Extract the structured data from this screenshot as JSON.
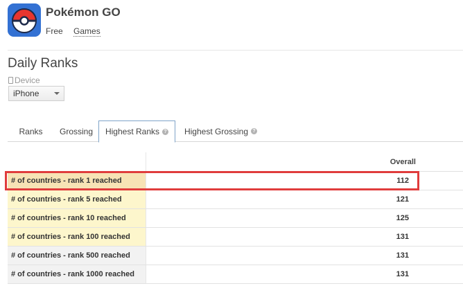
{
  "app": {
    "title": "Pokémon GO",
    "price": "Free",
    "category": "Games",
    "icon": "pokeball-icon"
  },
  "section": {
    "title": "Daily Ranks",
    "device_label": "Device",
    "device_value": "iPhone"
  },
  "tabs": [
    {
      "label": "Ranks"
    },
    {
      "label": "Grossing"
    },
    {
      "label": "Highest Ranks"
    },
    {
      "label": "Highest Grossing"
    }
  ],
  "table": {
    "column_header": "Overall",
    "rows": [
      {
        "label": "# of countries - rank 1 reached",
        "value": "112",
        "color": "#f7e3b5"
      },
      {
        "label": "# of countries - rank 5 reached",
        "value": "121",
        "color": "#fdf6cc"
      },
      {
        "label": "# of countries - rank 10 reached",
        "value": "125",
        "color": "#fdf6cc"
      },
      {
        "label": "# of countries - rank 100 reached",
        "value": "131",
        "color": "#fdf6cc"
      },
      {
        "label": "# of countries - rank 500 reached",
        "value": "131",
        "color": "#f2f2f2"
      },
      {
        "label": "# of countries - rank 1000 reached",
        "value": "131",
        "color": "#f2f2f2"
      }
    ]
  },
  "colors": {
    "highlight_border": "#e03c3c",
    "active_tab_border": "#7fa3c8"
  }
}
